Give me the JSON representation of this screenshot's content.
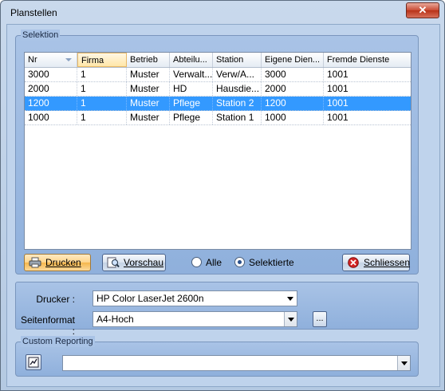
{
  "window": {
    "title": "Planstellen",
    "close_glyph": "✕"
  },
  "selektion": {
    "label": "Selektion",
    "columns": [
      "Nr",
      "Firma",
      "Betrieb",
      "Abteilu...",
      "Station",
      "Eigene Dien...",
      "Fremde Dienste"
    ],
    "rows": [
      [
        "3000",
        "1",
        "Muster",
        "Verwalt...",
        "Verw/A...",
        "3000",
        "1001"
      ],
      [
        "2000",
        "1",
        "Muster",
        "HD",
        "Hausdie...",
        "2000",
        "1001"
      ],
      [
        "1200",
        "1",
        "Muster",
        "Pflege",
        "Station 2",
        "1200",
        "1001"
      ],
      [
        "1000",
        "1",
        "Muster",
        "Pflege",
        "Station 1",
        "1000",
        "1001"
      ]
    ],
    "selected_row": 2,
    "sorted_column": "Nr"
  },
  "actions": {
    "drucken": "Drucken",
    "vorschau": "Vorschau",
    "alle": "Alle",
    "selektierte": "Selektierte",
    "selected_radio": "selektierte",
    "schliessen": "Schliessen"
  },
  "printer": {
    "drucker_label": "Drucker :",
    "drucker_value": "HP Color LaserJet 2600n",
    "seitenformat_label": "Seitenformat :",
    "seitenformat_value": "A4-Hoch",
    "browse_label": "..."
  },
  "custom_reporting": {
    "label": "Custom Reporting",
    "value": ""
  },
  "icons": {
    "printer": "printer-icon",
    "preview": "preview-icon",
    "close": "close-icon",
    "report": "report-icon"
  }
}
